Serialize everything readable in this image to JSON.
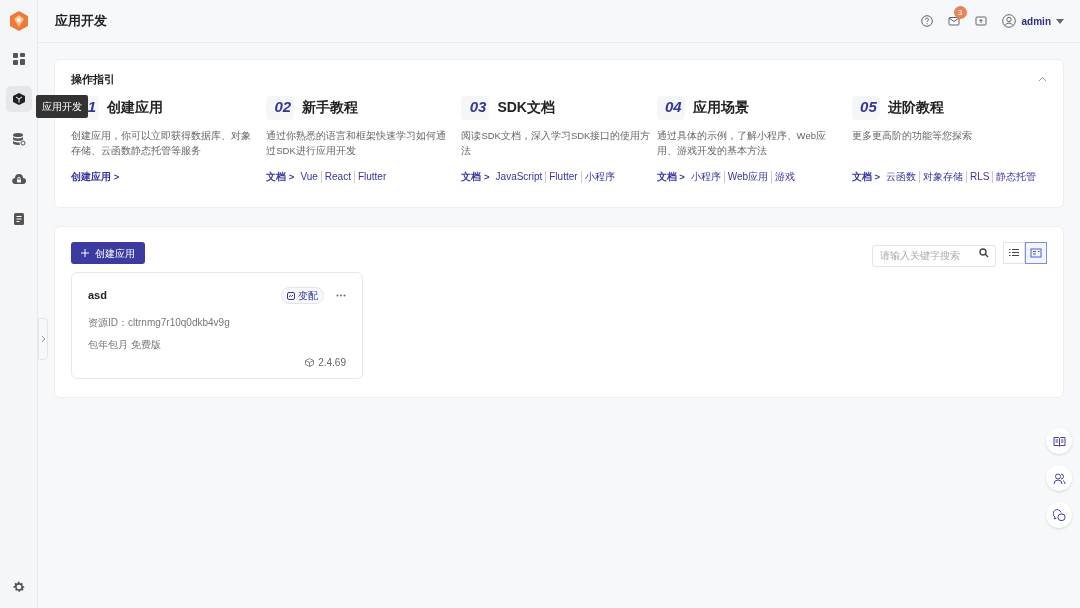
{
  "sidebar": {
    "items": [
      {
        "kind": "dashboard",
        "selected": false
      },
      {
        "kind": "cube",
        "selected": true
      },
      {
        "kind": "database",
        "selected": false
      },
      {
        "kind": "cloud",
        "selected": false
      },
      {
        "kind": "doc",
        "selected": false
      }
    ],
    "tooltip": "应用开发"
  },
  "header": {
    "title": "应用开发",
    "notification_count": "3",
    "user": "admin"
  },
  "guide": {
    "title": "操作指引",
    "steps": [
      {
        "number": "1",
        "title": "创建应用",
        "description": "创建应用，你可以立即获得数据库、对象存储、云函数静态托管等服务",
        "links": [
          {
            "kind": "lead",
            "text": "创建应用 >"
          }
        ]
      },
      {
        "number": "02",
        "title": "新手教程",
        "description": "通过你熟悉的语言和框架快速学习如何通过SDK进行应用开发",
        "links": [
          {
            "kind": "lead",
            "text": "文档 >"
          },
          {
            "kind": "item",
            "text": "Vue"
          },
          {
            "kind": "item",
            "text": "React"
          },
          {
            "kind": "item",
            "text": "Flutter"
          }
        ]
      },
      {
        "number": "03",
        "title": "SDK文档",
        "description": "阅读SDK文档，深入学习SDK接口的使用方法",
        "links": [
          {
            "kind": "lead",
            "text": "文档 >"
          },
          {
            "kind": "item",
            "text": "JavaScript"
          },
          {
            "kind": "item",
            "text": "Flutter"
          },
          {
            "kind": "item",
            "text": "小程序"
          }
        ]
      },
      {
        "number": "04",
        "title": "应用场景",
        "description": "通过具体的示例，了解小程序、Web应用、游戏开发的基本方法",
        "links": [
          {
            "kind": "lead",
            "text": "文档 >"
          },
          {
            "kind": "item",
            "text": "小程序"
          },
          {
            "kind": "item",
            "text": "Web应用"
          },
          {
            "kind": "item",
            "text": "游戏"
          }
        ]
      },
      {
        "number": "05",
        "title": "进阶教程",
        "description": "更多更高阶的功能等您探索",
        "links": [
          {
            "kind": "lead",
            "text": "文档 >"
          },
          {
            "kind": "item",
            "text": "云函数"
          },
          {
            "kind": "item",
            "text": "对象存储"
          },
          {
            "kind": "item",
            "text": "RLS"
          },
          {
            "kind": "item",
            "text": "静态托管"
          }
        ]
      }
    ]
  },
  "apps": {
    "create_button": "创建应用",
    "search": {
      "placeholder": "请输入关键字搜索"
    },
    "views": [
      {
        "kind": "list",
        "selected": false
      },
      {
        "kind": "card",
        "selected": true
      }
    ],
    "cards": [
      {
        "name": "asd",
        "action": "变配",
        "resource_id": "资源ID：cltrnmg7r10q0dkb4v9g",
        "plan": "包年包月 免费版",
        "version": "2.4.69"
      }
    ]
  }
}
